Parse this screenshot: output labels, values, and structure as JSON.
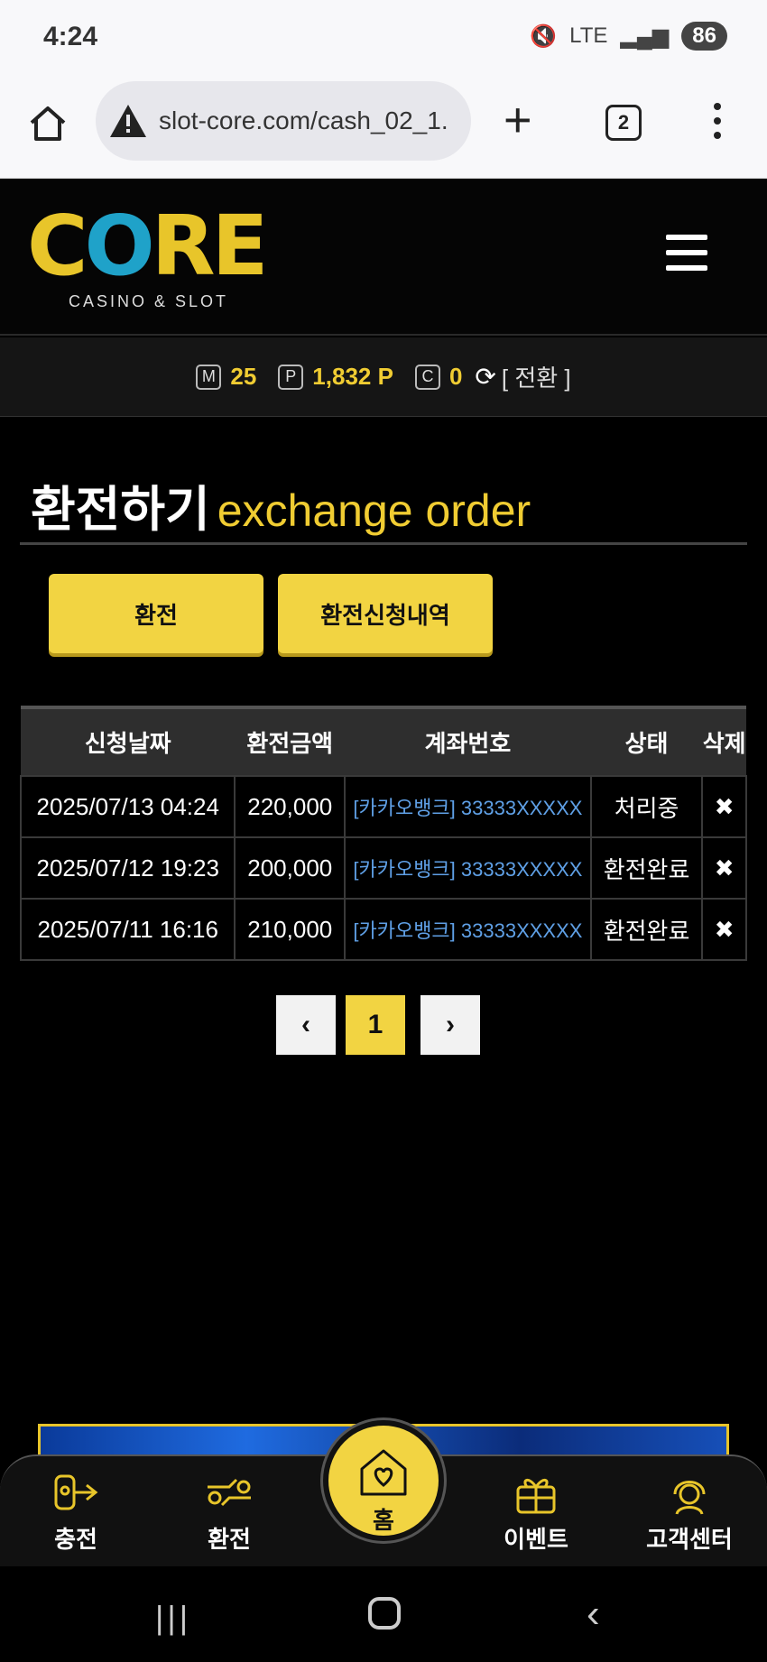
{
  "statusbar": {
    "time": "4:24",
    "network": "LTE",
    "battery": "86"
  },
  "browser": {
    "url": "slot-core.com/cash_02_1.",
    "tab_count": "2"
  },
  "site": {
    "logo_word": "CORE",
    "logo_sub": "CASINO & SLOT",
    "brand_color": "#f0cc32"
  },
  "points": {
    "m_icon": "M",
    "m_value": "25",
    "p_icon": "P",
    "p_value": "1,832 P",
    "c_icon": "C",
    "c_value": "0",
    "convert_label": "[ 전환 ]"
  },
  "page": {
    "title_ko": "환전하기",
    "title_en": "exchange order"
  },
  "buttons": {
    "exchange": "환전",
    "history": "환전신청내역"
  },
  "table": {
    "headers": [
      "신청날짜",
      "환전금액",
      "계좌번호",
      "상태",
      "삭제"
    ],
    "rows": [
      {
        "date": "2025/07/13 04:24",
        "amount": "220,000",
        "account": "[카카오뱅크] 33333XXXXX",
        "status": "처리중",
        "delete": "✖"
      },
      {
        "date": "2025/07/12 19:23",
        "amount": "200,000",
        "account": "[카카오뱅크] 33333XXXXX",
        "status": "환전완료",
        "delete": "✖"
      },
      {
        "date": "2025/07/11 16:16",
        "amount": "210,000",
        "account": "[카카오뱅크] 33333XXXXX",
        "status": "환전완료",
        "delete": "✖"
      }
    ]
  },
  "pagination": {
    "prev": "‹",
    "current": "1",
    "next": "›"
  },
  "bottomnav": {
    "deposit": "충전",
    "exchange": "환전",
    "home": "홈",
    "event": "이벤트",
    "support": "고객센터"
  }
}
